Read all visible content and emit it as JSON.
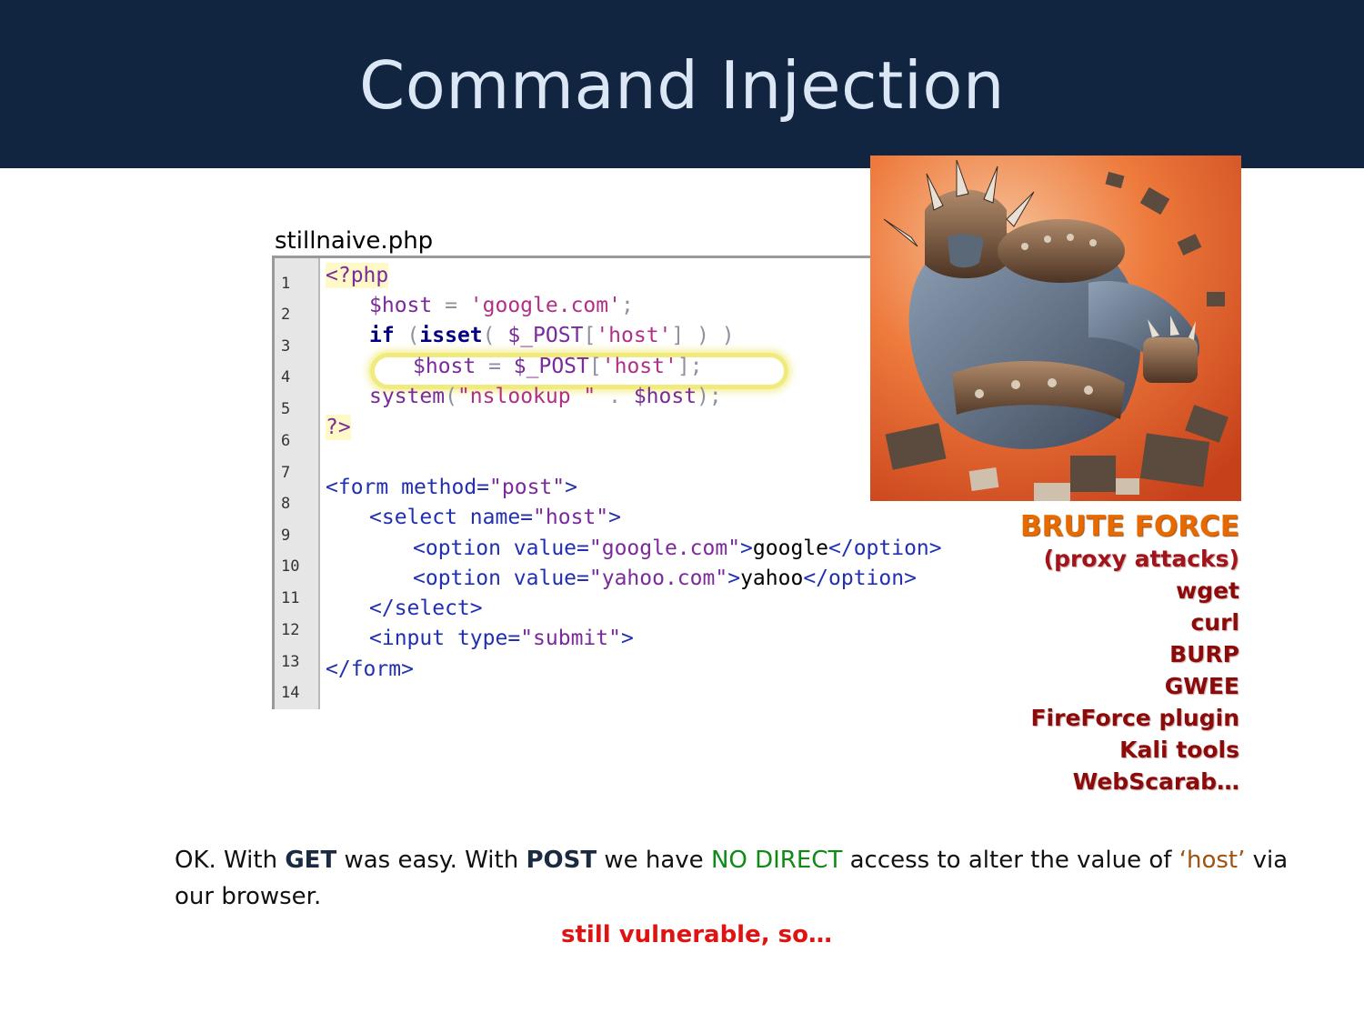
{
  "slide": {
    "title": "Command Injection",
    "filename": "stillnaive.php"
  },
  "code": {
    "line_numbers": [
      "1",
      "2",
      "3",
      "4",
      "5",
      "6",
      "7",
      "8",
      "9",
      "10",
      "11",
      "12",
      "13",
      "14"
    ],
    "lines": {
      "l1": "<?php",
      "l2_var": "$host",
      "l2_op": " = ",
      "l2_str": "'google.com'",
      "l2_end": ";",
      "l3_kw": "if",
      "l3_op1": " (",
      "l3_fn": "isset",
      "l3_op2": "( ",
      "l3_var": "$_POST",
      "l3_op3": "[",
      "l3_str": "'host'",
      "l3_op4": "] ) )",
      "l4_var1": "$host",
      "l4_op1": " = ",
      "l4_var2": "$_POST",
      "l4_op2": "[",
      "l4_str": "'host'",
      "l4_op3": "];",
      "l5_fn": "system",
      "l5_op1": "(",
      "l5_str": "\"nslookup \"",
      "l5_op2": " . ",
      "l5_var": "$host",
      "l5_op3": ");",
      "l6": "?>",
      "l8_tag": "<form",
      "l8_attr": " method=",
      "l8_val": "\"post\"",
      "l8_end": ">",
      "l9_tag": "<select",
      "l9_attr": " name=",
      "l9_val": "\"host\"",
      "l9_end": ">",
      "l10_tag": "<option",
      "l10_attr": " value=",
      "l10_val": "\"google.com\"",
      "l10_gt": ">",
      "l10_txt": "google",
      "l10_close": "</option>",
      "l11_tag": "<option",
      "l11_attr": " value=",
      "l11_val": "\"yahoo.com\"",
      "l11_gt": ">",
      "l11_txt": "yahoo",
      "l11_close": "</option>",
      "l12": "</select>",
      "l13_tag": "<input",
      "l13_attr": " type=",
      "l13_val": "\"submit\"",
      "l13_end": ">",
      "l14": "</form>"
    }
  },
  "tools": {
    "heading": "BRUTE FORCE",
    "subheading": "(proxy attacks)",
    "items": [
      "wget",
      "curl",
      "BURP",
      "GWEE",
      "FireForce plugin",
      "Kali tools",
      "WebScarab…"
    ]
  },
  "body": {
    "p1": "OK. With ",
    "get": "GET",
    "p2": " was easy. With ",
    "post": "POST",
    "p3": " we have ",
    "no_direct": "NO DIRECT",
    "p4": " access to alter the value of ",
    "host_q": "‘host’",
    "p5": " via our browser.",
    "footer": "still vulnerable, so…"
  },
  "colors": {
    "title_bar": "#112541",
    "heading_orange": "#e76a00",
    "tool_red": "#8b0a0a",
    "footer_red": "#e11212"
  }
}
